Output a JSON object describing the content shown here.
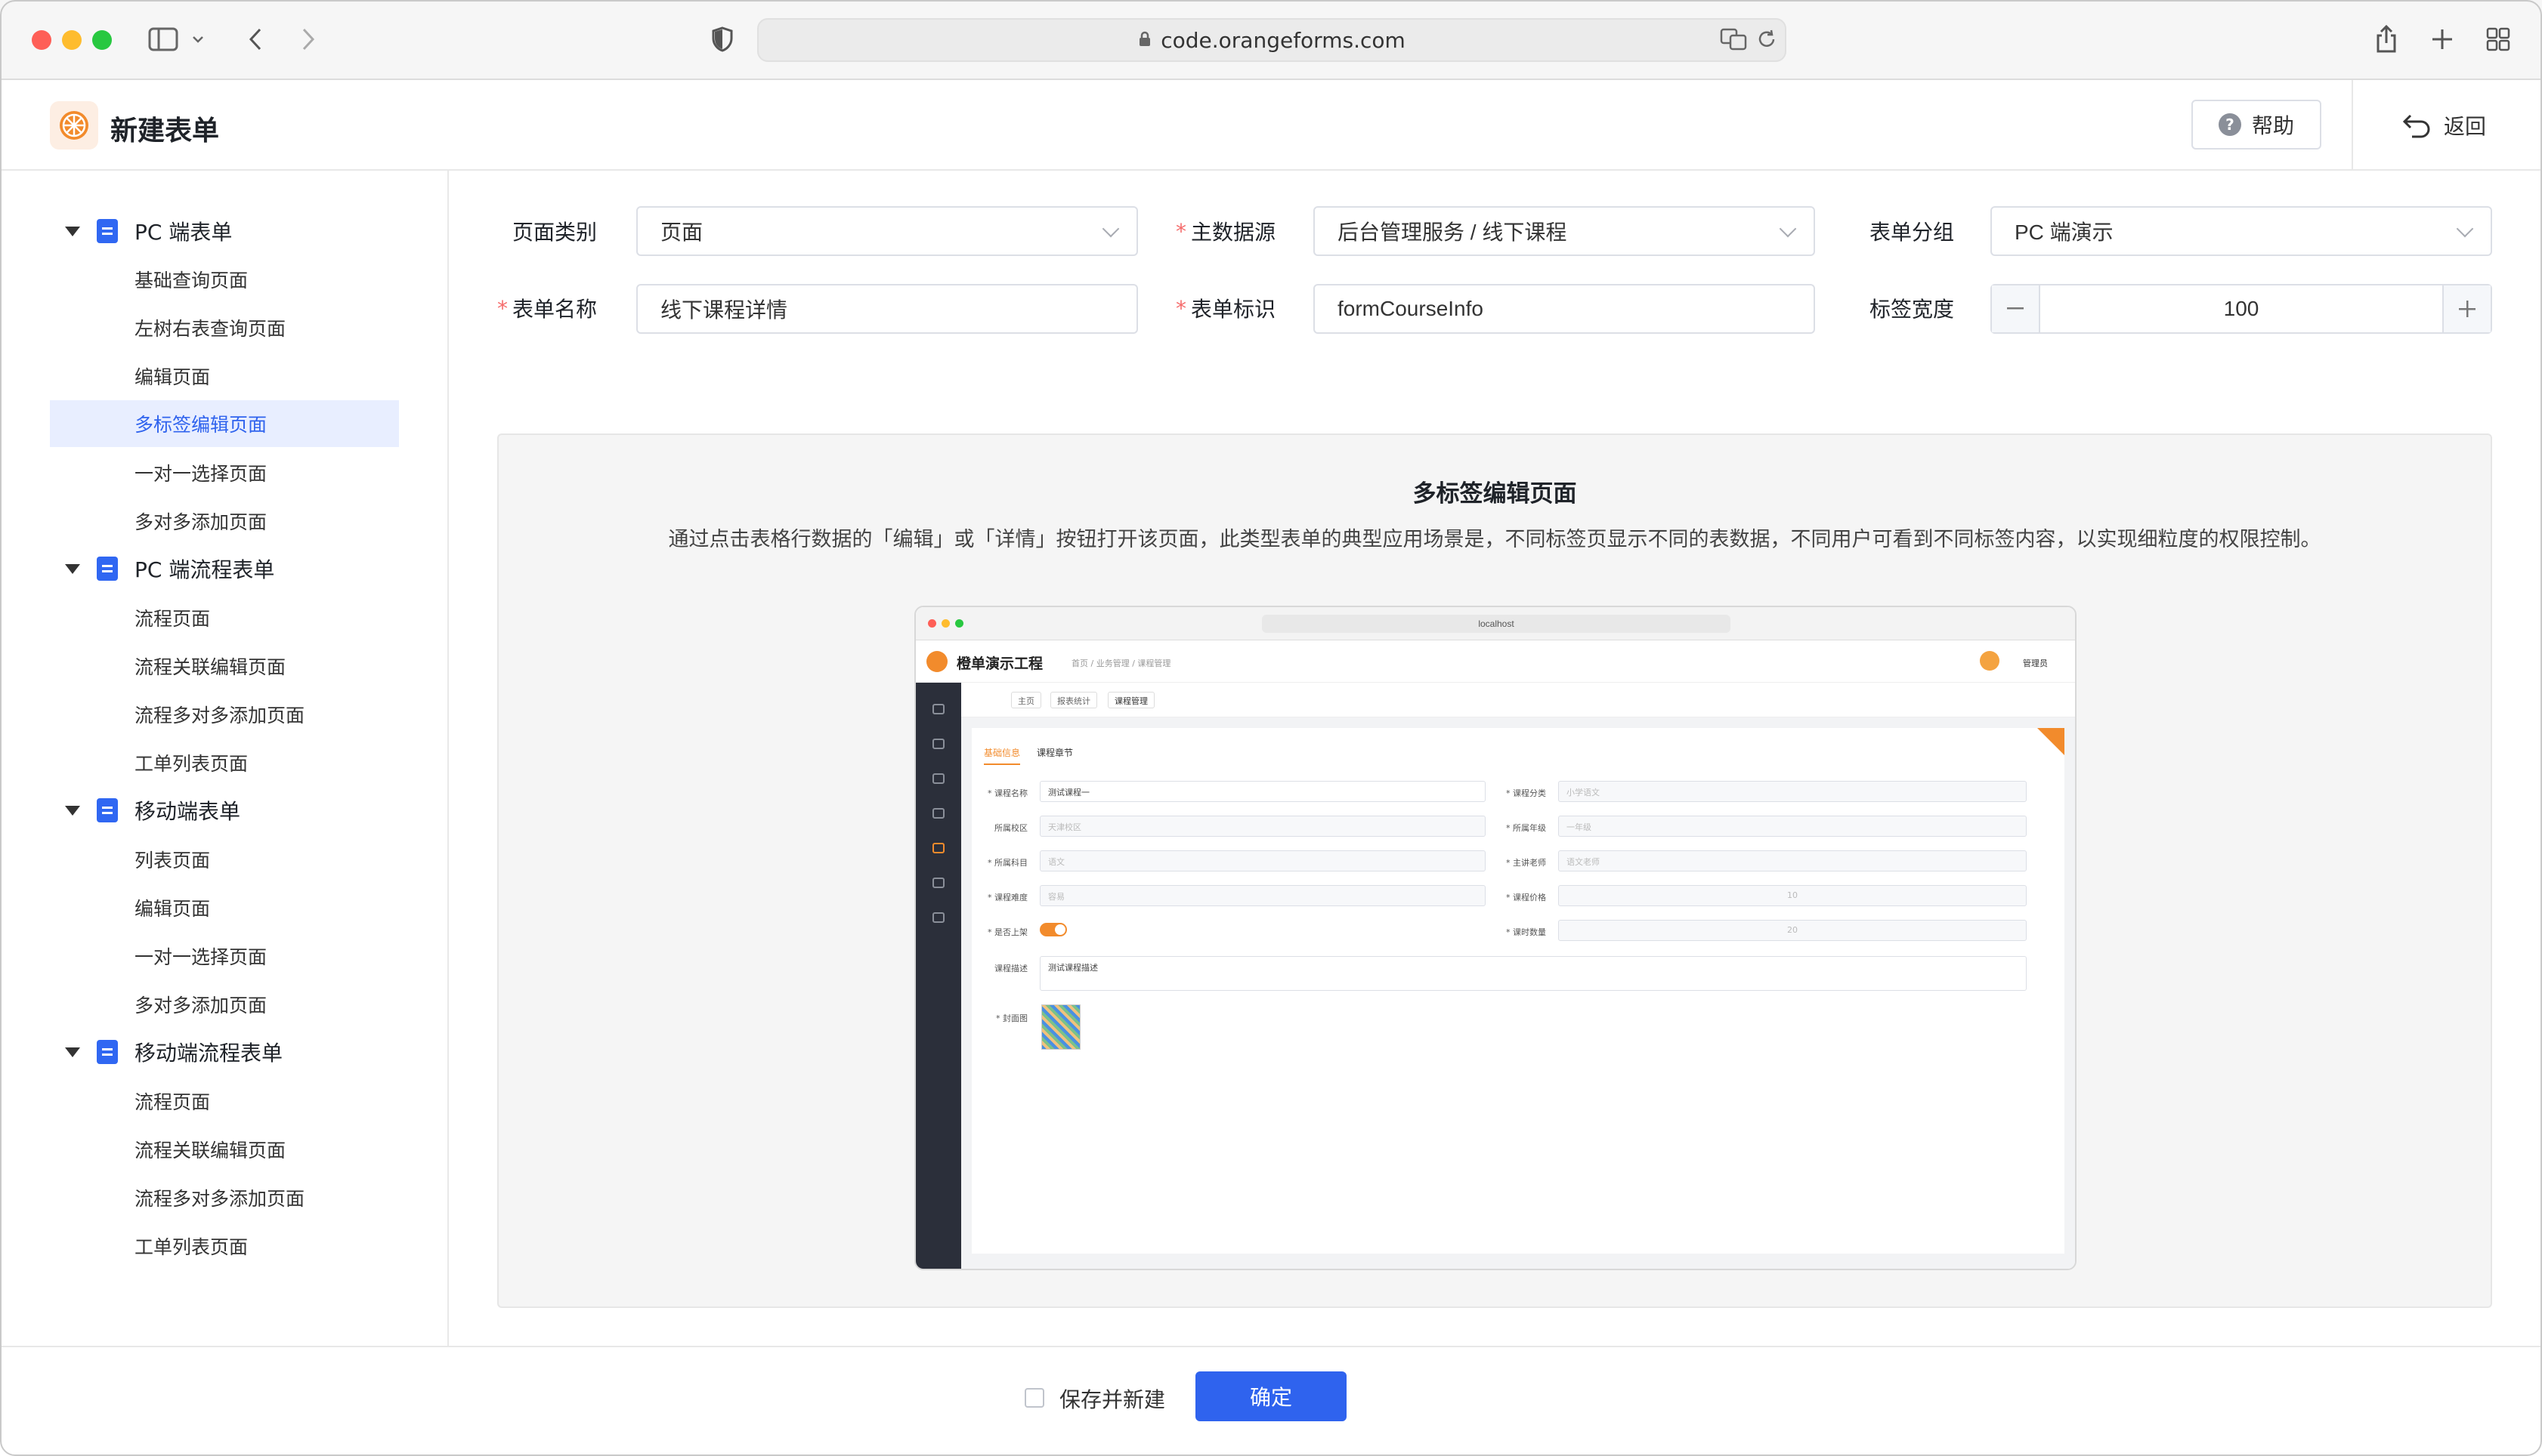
{
  "browser": {
    "url": "code.orangeforms.com"
  },
  "header": {
    "title": "新建表单",
    "help_label": "帮助",
    "back_label": "返回"
  },
  "sidebar": {
    "groups": [
      {
        "label": "PC 端表单",
        "items": [
          "基础查询页面",
          "左树右表查询页面",
          "编辑页面",
          "多标签编辑页面",
          "一对一选择页面",
          "多对多添加页面"
        ]
      },
      {
        "label": "PC 端流程表单",
        "items": [
          "流程页面",
          "流程关联编辑页面",
          "流程多对多添加页面",
          "工单列表页面"
        ]
      },
      {
        "label": "移动端表单",
        "items": [
          "列表页面",
          "编辑页面",
          "一对一选择页面",
          "多对多添加页面"
        ]
      },
      {
        "label": "移动端流程表单",
        "items": [
          "流程页面",
          "流程关联编辑页面",
          "流程多对多添加页面",
          "工单列表页面"
        ]
      }
    ],
    "active_item": "多标签编辑页面"
  },
  "form": {
    "page_type_label": "页面类别",
    "page_type_value": "页面",
    "main_datasource_label": "主数据源",
    "main_datasource_value": "后台管理服务 / 线下课程",
    "form_group_label": "表单分组",
    "form_group_value": "PC 端演示",
    "form_name_label": "表单名称",
    "form_name_value": "线下课程详情",
    "form_key_label": "表单标识",
    "form_key_value": "formCourseInfo",
    "label_width_label": "标签宽度",
    "label_width_value": "100",
    "required_mark": "*"
  },
  "preview": {
    "title": "多标签编辑页面",
    "description": "通过点击表格行数据的「编辑」或「详情」按钮打开该页面，此类型表单的典型应用场景是，不同标签页显示不同的表数据，不同用户可看到不同标签内容，以实现细粒度的权限控制。",
    "mini": {
      "url": "localhost",
      "app_title": "橙单演示工程",
      "breadcrumb": "首页 / 业务管理 / 课程管理",
      "user": "管理员",
      "tabs": [
        "主页",
        "报表统计",
        "课程管理"
      ],
      "sub_tabs": [
        "基础信息",
        "课程章节"
      ],
      "fields": [
        {
          "label": "* 课程名称",
          "value": "测试课程一"
        },
        {
          "label": "* 课程分类",
          "value": "小学语文"
        },
        {
          "label": "所属校区",
          "value": "天津校区"
        },
        {
          "label": "* 所属年级",
          "value": "一年级"
        },
        {
          "label": "* 所属科目",
          "value": "语文"
        },
        {
          "label": "* 主讲老师",
          "value": "语文老师"
        },
        {
          "label": "* 课程难度",
          "value": "容易"
        },
        {
          "label": "* 课程价格",
          "value": "10"
        },
        {
          "label": "* 是否上架",
          "value": ""
        },
        {
          "label": "* 课时数量",
          "value": "20"
        },
        {
          "label": "课程描述",
          "value": "测试课程描述"
        },
        {
          "label": "* 封面图",
          "value": ""
        }
      ]
    }
  },
  "footer": {
    "save_new_label": "保存并新建",
    "confirm_label": "确定"
  },
  "colors": {
    "primary": "#2f63ee",
    "brand_orange": "#f28b2c",
    "required": "#f56c6c"
  }
}
